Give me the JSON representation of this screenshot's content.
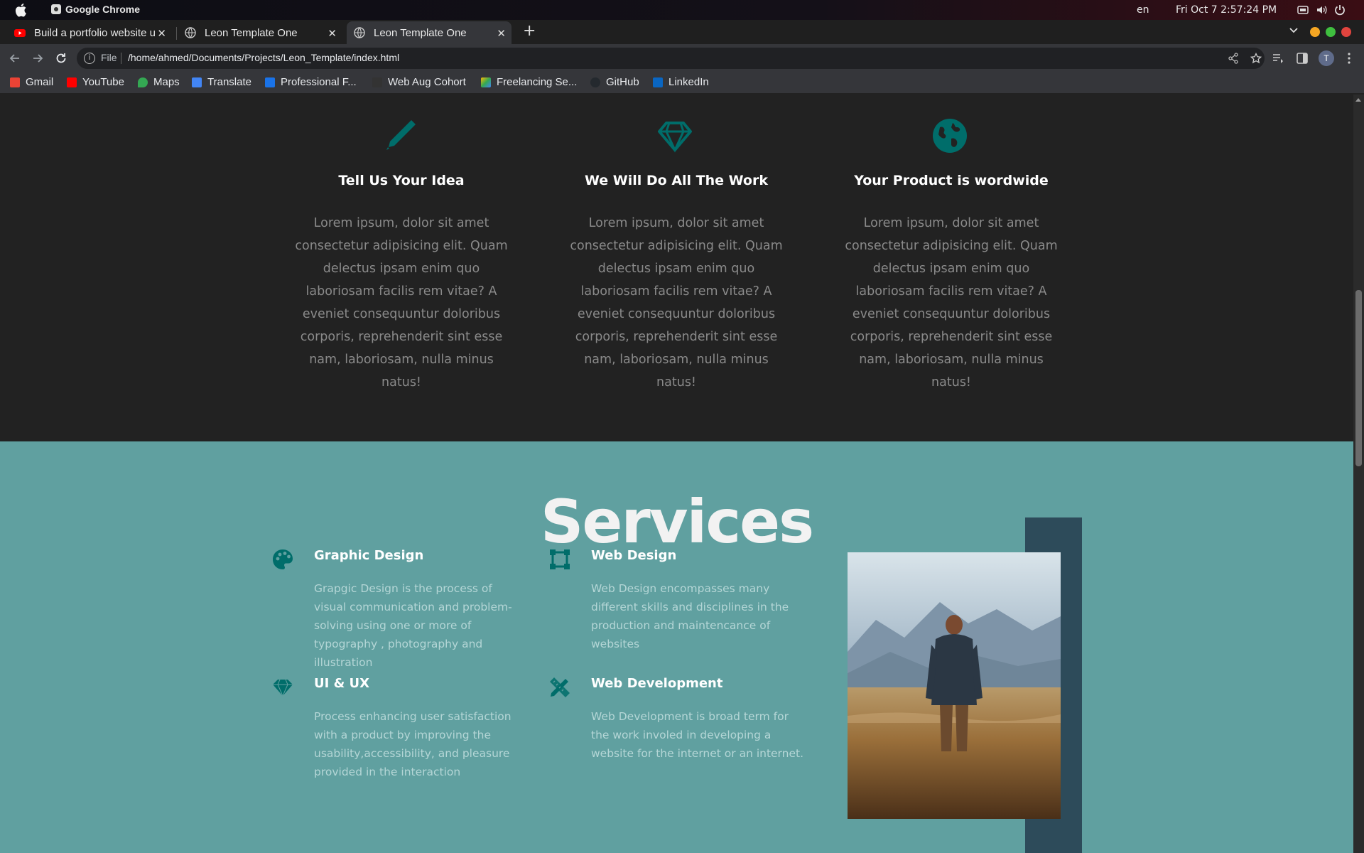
{
  "os": {
    "app_name": "Google Chrome",
    "lang": "en",
    "datetime": "Fri Oct 7   2:57:24 PM"
  },
  "tabs": [
    {
      "title": "Build a portfolio website u",
      "favicon": "youtube-icon"
    },
    {
      "title": "Leon Template One",
      "favicon": "globe-icon"
    },
    {
      "title": "Leon Template One",
      "favicon": "globe-icon"
    }
  ],
  "address": {
    "scheme_label": "File",
    "url": "/home/ahmed/Documents/Projects/Leon_Template/index.html",
    "profile_initial": "T"
  },
  "bookmarks": [
    {
      "label": "Gmail",
      "color": "#ea4335"
    },
    {
      "label": "YouTube",
      "color": "#ff0000"
    },
    {
      "label": "Maps",
      "color": "#34a853"
    },
    {
      "label": "Translate",
      "color": "#4285f4"
    },
    {
      "label": "Professional F...",
      "color": "#1a73e8"
    },
    {
      "label": "Web Aug Cohort",
      "color": "#333333"
    },
    {
      "label": "Freelancing Se...",
      "color": "#fbbc04"
    },
    {
      "label": "GitHub",
      "color": "#24292e"
    },
    {
      "label": "LinkedIn",
      "color": "#0a66c2"
    }
  ],
  "features": [
    {
      "icon": "pen-icon",
      "title": "Tell Us Your Idea",
      "text": "Lorem ipsum, dolor sit amet consectetur adipisicing elit. Quam delectus ipsam enim quo laboriosam facilis rem vitae? A eveniet consequuntur doloribus corporis, reprehenderit sint esse nam, laboriosam, nulla minus natus!"
    },
    {
      "icon": "gem-icon",
      "title": "We Will Do All The Work",
      "text": "Lorem ipsum, dolor sit amet consectetur adipisicing elit. Quam delectus ipsam enim quo laboriosam facilis rem vitae? A eveniet consequuntur doloribus corporis, reprehenderit sint esse nam, laboriosam, nulla minus natus!"
    },
    {
      "icon": "globe-icon",
      "title": "Your Product is wordwide",
      "text": "Lorem ipsum, dolor sit amet consectetur adipisicing elit. Quam delectus ipsam enim quo laboriosam facilis rem vitae? A eveniet consequuntur doloribus corporis, reprehenderit sint esse nam, laboriosam, nulla minus natus!"
    }
  ],
  "services": {
    "title": "Services",
    "items": [
      {
        "icon": "palette-icon",
        "title": "Graphic Design",
        "desc": "Grapgic Design is the process of visual communication and problem-solving using one or more of typography , photography and illustration"
      },
      {
        "icon": "vector-square-icon",
        "title": "Web Design",
        "desc": "Web Design encompasses many different skills and disciplines in the production and maintencance of websites"
      },
      {
        "icon": "gem-icon",
        "title": "UI & UX",
        "desc": "Process enhancing user satisfaction with a product by improving the usability,accessibility, and pleasure provided in the interaction"
      },
      {
        "icon": "pencil-ruler-icon",
        "title": "Web Development",
        "desc": "Web Development is broad term for the work involed in developing a website for the internet or an internet."
      }
    ]
  },
  "colors": {
    "accent": "#006d6a",
    "dark_bg": "#222222",
    "services_bg": "#60a0a0",
    "photo_frame": "#2d4b5a"
  }
}
